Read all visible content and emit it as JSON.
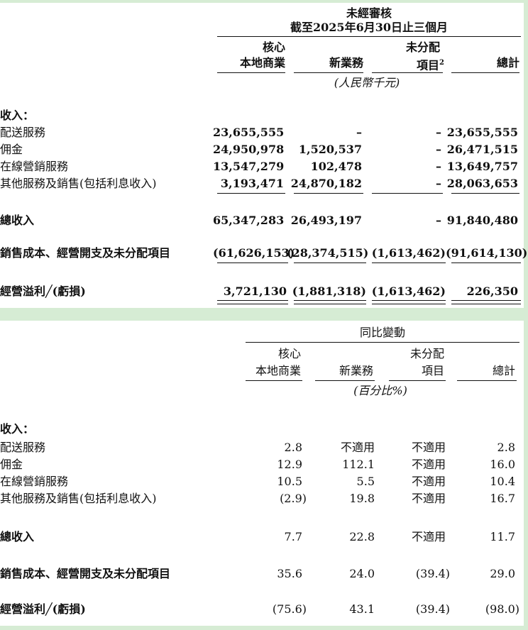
{
  "table1": {
    "header": {
      "title": "未經審核",
      "subtitle": "截至2025年6月30日止三個月",
      "col1_l1": "核心",
      "col1_l2": "本地商業",
      "col2": "新業務",
      "col3_l1": "未分配",
      "col3_l2": "項目",
      "col3_sup": "2",
      "col4": "總計",
      "unit": "(人民幣千元)"
    },
    "revenue_label": "收入：",
    "rows": [
      {
        "label": "配送服務",
        "v1": "23,655,555",
        "v2": "–",
        "v3": "–",
        "v4": "23,655,555"
      },
      {
        "label": "佣金",
        "v1": "24,950,978",
        "v2": "1,520,537",
        "v3": "–",
        "v4": "26,471,515"
      },
      {
        "label": "在線營銷服務",
        "v1": "13,547,279",
        "v2": "102,478",
        "v3": "–",
        "v4": "13,649,757"
      },
      {
        "label": "其他服務及銷售(包括利息收入)",
        "v1": "3,193,471",
        "v2": "24,870,182",
        "v3": "–",
        "v4": "28,063,653"
      }
    ],
    "total": {
      "label": "總收入",
      "v1": "65,347,283",
      "v2": "26,493,197",
      "v3": "–",
      "v4": "91,840,480"
    },
    "cost": {
      "label": "銷售成本、經營開支及未分配項目",
      "v1": "(61,626,153)",
      "v2": "(28,374,515)",
      "v3": "(1,613,462)",
      "v4": "(91,614,130)"
    },
    "profit": {
      "label": "經營溢利╱(虧損)",
      "v1": "3,721,130",
      "v2": "(1,881,318)",
      "v3": "(1,613,462)",
      "v4": "226,350"
    }
  },
  "table2": {
    "header": {
      "title": "同比變動",
      "col1_l1": "核心",
      "col1_l2": "本地商業",
      "col2": "新業務",
      "col3_l1": "未分配",
      "col3_l2": "項目",
      "col4": "總計",
      "unit": "(百分比%)"
    },
    "revenue_label": "收入：",
    "rows": [
      {
        "label": "配送服務",
        "v1": "2.8",
        "v2": "不適用",
        "v3": "不適用",
        "v4": "2.8"
      },
      {
        "label": "佣金",
        "v1": "12.9",
        "v2": "112.1",
        "v3": "不適用",
        "v4": "16.0"
      },
      {
        "label": "在線營銷服務",
        "v1": "10.5",
        "v2": "5.5",
        "v3": "不適用",
        "v4": "10.4"
      },
      {
        "label": "其他服務及銷售(包括利息收入)",
        "v1": "(2.9)",
        "v2": "19.8",
        "v3": "不適用",
        "v4": "16.7"
      }
    ],
    "total": {
      "label": "總收入",
      "v1": "7.7",
      "v2": "22.8",
      "v3": "不適用",
      "v4": "11.7"
    },
    "cost": {
      "label": "銷售成本、經營開支及未分配項目",
      "v1": "35.6",
      "v2": "24.0",
      "v3": "(39.4)",
      "v4": "29.0"
    },
    "profit": {
      "label": "經營溢利╱(虧損)",
      "v1": "(75.6)",
      "v2": "43.1",
      "v3": "(39.4)",
      "v4": "(98.0)"
    }
  }
}
